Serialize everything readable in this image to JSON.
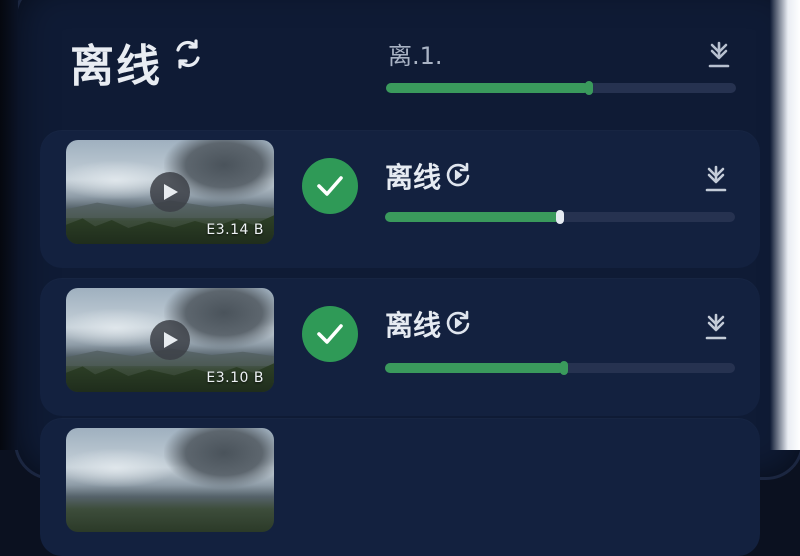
{
  "header": {
    "title": "离线",
    "progress_label": "离.1.",
    "progress_fraction": 0.58
  },
  "items": [
    {
      "title": "离线",
      "size": "E3.14 B",
      "progress_fraction": 0.5,
      "status_icon": "check-icon",
      "action_icon": "sync-play-icon"
    },
    {
      "title": "离线",
      "size": "E3.10 B",
      "progress_fraction": 0.51,
      "status_icon": "check-icon",
      "action_icon": "sync-play-icon"
    }
  ],
  "colors": {
    "background": "#0f1b35",
    "card": "#13213f",
    "accent_green": "#3a9a5c",
    "check_green": "#2f9a57"
  }
}
